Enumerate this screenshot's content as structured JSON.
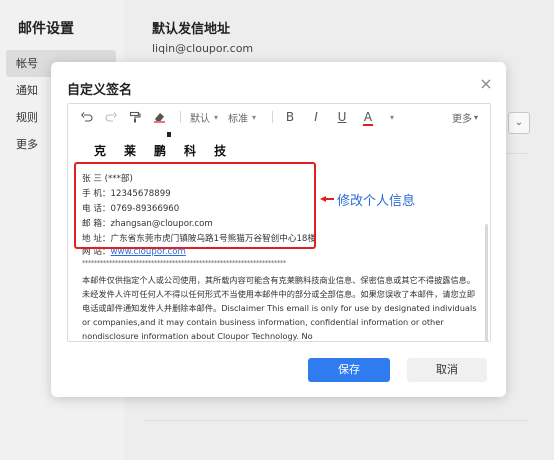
{
  "settings": {
    "sidebar_title": "邮件设置",
    "nav": [
      {
        "label": "帐号",
        "active": true
      },
      {
        "label": "通知",
        "active": false
      },
      {
        "label": "规则",
        "active": false
      },
      {
        "label": "更多",
        "active": false
      }
    ],
    "main_title": "默认发信地址",
    "main_email": "liqin@cloupor.com",
    "select_caret": "⌄"
  },
  "modal": {
    "title": "自定义签名",
    "close_icon": "×",
    "toolbar": {
      "undo_icon": "undo-icon",
      "redo_icon": "redo-icon",
      "format_painter_icon": "format-painter-icon",
      "eraser_icon": "eraser-icon",
      "font_select": "默认",
      "size_select": "标准",
      "bold": "B",
      "italic": "I",
      "underline": "U",
      "font_color": "A",
      "font_color_value": "#e02020",
      "more": "更多"
    },
    "company_chars": [
      "克",
      "莱",
      "鹏",
      "科",
      "技"
    ],
    "signature_lines": [
      "张 三  (***部)",
      "手 机：12345678899",
      "电 话：0769-89366960",
      "邮 箱：zhangsan@cloupor.com",
      "地 址：广东省东莞市虎门镇陂乌路1号熊猫万谷智创中心18楼"
    ],
    "website_label": "网 站：",
    "website_link": "www.cloupor.com",
    "stars": "********************************************************************",
    "disclaimer": "本邮件仅供指定个人或公司使用，其所载内容可能含有克莱鹏科技商业信息、保密信息或其它不得披露信息。未经发件人许可任何人不得以任何形式不当使用本邮件中的部分或全部信息。如果您误收了本邮件，请您立即电话或邮件通知发件人并删除本邮件。Disclaimer This email is only for use by designated individuals or companies,and it may contain business information, confidential information or other nondisclosure information about Cloupor Technology. No",
    "annotation": "修改个人信息",
    "save_label": "保存",
    "cancel_label": "取消"
  },
  "colors": {
    "accent": "#2e7cf0",
    "highlight": "#e02020",
    "annotation_text": "#2a6cd6"
  }
}
